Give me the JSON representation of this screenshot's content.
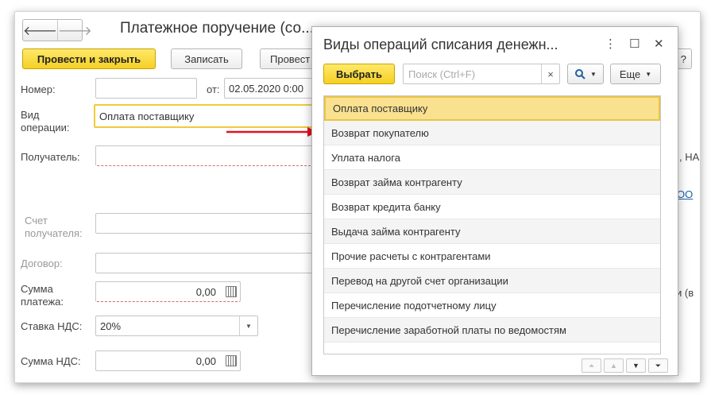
{
  "form": {
    "title": "Платежное поручение (со...",
    "nav_back": "🡐",
    "nav_forward": "🡒",
    "toolbar": {
      "post_close": "Провести и закрыть",
      "save": "Записать",
      "post": "Провест"
    },
    "fields": {
      "number_label": "Номер:",
      "number_value": "",
      "date_label": "от:",
      "date_value": "02.05.2020  0:00",
      "operation_label": "Вид\nоперации:",
      "operation_value": "Оплата поставщику",
      "recipient_label": "Получатель:",
      "account_label": "Счет\nполучателя:",
      "contract_label": "Договор:",
      "amount_label": "Сумма\nплатежа:",
      "amount_value": "0,00",
      "vat_rate_label": "Ставка НДС:",
      "vat_rate_value": "20%",
      "vat_amount_label": "Сумма НДС:",
      "vat_amount_value": "0,00"
    },
    "right_edge": {
      "settings_char": "?",
      "recipient_fragment": ", НА",
      "link_fragment": "ОО",
      "amount_fragment": "и (в"
    }
  },
  "dialog": {
    "title": "Виды операций списания денежн...",
    "more_icon": "⋮",
    "maximize_icon": "☐",
    "close_icon": "✕",
    "select_button": "Выбрать",
    "search_placeholder": "Поиск (Ctrl+F)",
    "search_clear": "×",
    "more_button": "Еще",
    "items": [
      "Оплата поставщику",
      "Возврат покупателю",
      "Уплата налога",
      "Возврат займа контрагенту",
      "Возврат кредита банку",
      "Выдача займа контрагенту",
      "Прочие расчеты с контрагентами",
      "Перевод на другой счет организации",
      "Перечисление подотчетному лицу",
      "Перечисление заработной платы по ведомостям"
    ],
    "selected_index": 0
  },
  "colors": {
    "accent_yellow": "#f5cf24",
    "selected_row": "#f9e18f",
    "arrow_red": "#e0141e"
  }
}
